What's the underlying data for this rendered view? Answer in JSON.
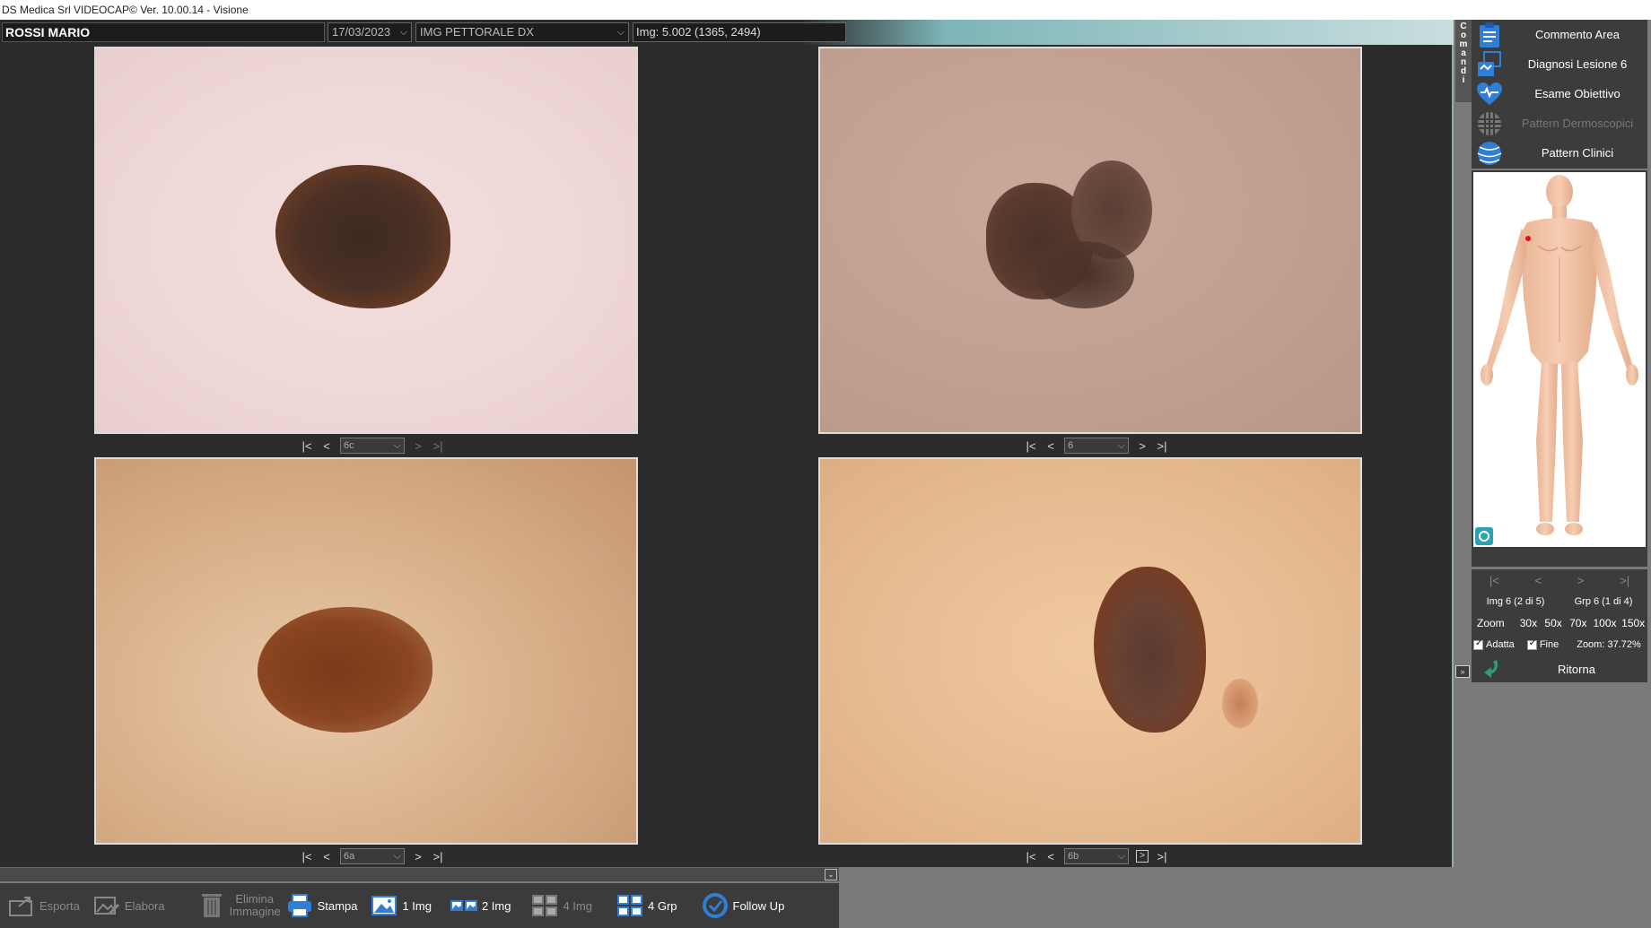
{
  "window": {
    "title": "DS Medica Srl VIDEOCAP© Ver. 10.00.14 - Visione"
  },
  "header": {
    "patient_name": "ROSSI MARIO",
    "date": "17/03/2023",
    "image_label": "IMG PETTORALE DX",
    "image_info": "Img: 5.002 (1365, 2494)"
  },
  "viewers": [
    {
      "id": "top-left",
      "selected": "6c"
    },
    {
      "id": "top-right",
      "selected": "6"
    },
    {
      "id": "bottom-left",
      "selected": "6a"
    },
    {
      "id": "bottom-right",
      "selected": "6b"
    }
  ],
  "nav": {
    "first": "|<",
    "prev": "<",
    "next": ">",
    "last": ">|"
  },
  "sidebar": {
    "comandi_label": "Comandi",
    "menu": [
      {
        "label": "Commento Area",
        "enabled": true,
        "icon": "clipboard-icon"
      },
      {
        "label": "Diagnosi Lesione 6",
        "enabled": true,
        "icon": "diagnosis-icon"
      },
      {
        "label": "Esame Obiettivo",
        "enabled": true,
        "icon": "heart-icon"
      },
      {
        "label": "Pattern Dermoscopici",
        "enabled": false,
        "icon": "grid-pattern-icon"
      },
      {
        "label": "Pattern Clinici",
        "enabled": true,
        "icon": "globe-pattern-icon"
      }
    ],
    "img_counter": "Img 6 (2 di 5)",
    "grp_counter": "Grp 6 (1 di 4)",
    "zoom_label": "Zoom",
    "zoom_levels": [
      "30x",
      "50x",
      "70x",
      "100x",
      "150x"
    ],
    "adatta_label": "Adatta",
    "fine_label": "Fine",
    "zoom_value": "Zoom: 37.72%",
    "ritorna_label": "Ritorna"
  },
  "toolbar": {
    "items": [
      {
        "label": "Esporta",
        "enabled": false
      },
      {
        "label": "Elabora",
        "enabled": false
      },
      {
        "label": "Elimina Immagine",
        "enabled": false
      },
      {
        "label": "Stampa",
        "enabled": true
      },
      {
        "label": "1 Img",
        "enabled": true
      },
      {
        "label": "2 Img",
        "enabled": true
      },
      {
        "label": "4 Img",
        "enabled": false
      },
      {
        "label": "4 Grp",
        "enabled": true
      },
      {
        "label": "Follow Up",
        "enabled": true
      }
    ]
  },
  "colors": {
    "accent_blue": "#2f7fd6",
    "panel_dark": "#2c2c2c",
    "marker_red": "#e01010"
  }
}
